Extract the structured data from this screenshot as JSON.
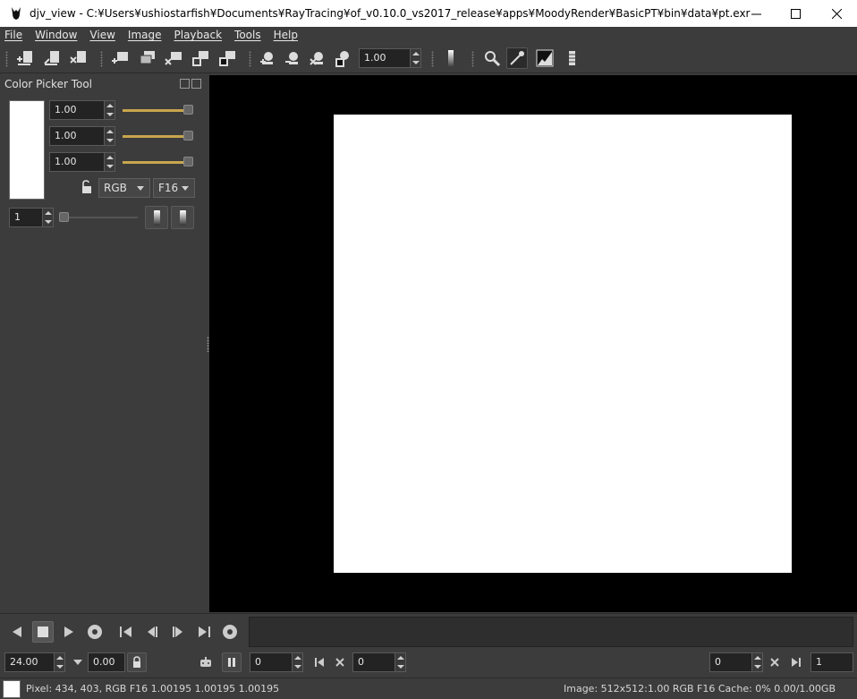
{
  "window": {
    "title": "djv_view - C:¥Users¥ushiostarfish¥Documents¥RayTracing¥of_v0.10.0_vs2017_release¥apps¥MoodyRender¥BasicPT¥bin¥data¥pt.exr"
  },
  "menu": {
    "items": [
      "File",
      "Window",
      "View",
      "Image",
      "Playback",
      "Tools",
      "Help"
    ]
  },
  "toolbar": {
    "zoom_value": "1.00"
  },
  "color_picker": {
    "title": "Color Picker Tool",
    "channels": [
      "1.00",
      "1.00",
      "1.00"
    ],
    "color_profile": "RGB",
    "pixel_type": "F16",
    "sample_size": "1",
    "swatch_color": "#ffffff"
  },
  "viewer": {
    "background": "#000000",
    "image_color": "#ffffff"
  },
  "playback": {
    "speed": "24.00",
    "actual_speed": "0.00",
    "current_frame": "0",
    "in_point": "0",
    "out_point": "0",
    "duration": "1"
  },
  "status": {
    "pixel_info": "Pixel: 434, 403, RGB F16 1.00195 1.00195 1.00195",
    "image_info": "Image: 512x512:1.00 RGB F16  Cache: 0% 0.00/1.00GB"
  },
  "colors": {
    "panel_bg": "#3c3c3c",
    "slider_accent": "#c8a64e"
  }
}
